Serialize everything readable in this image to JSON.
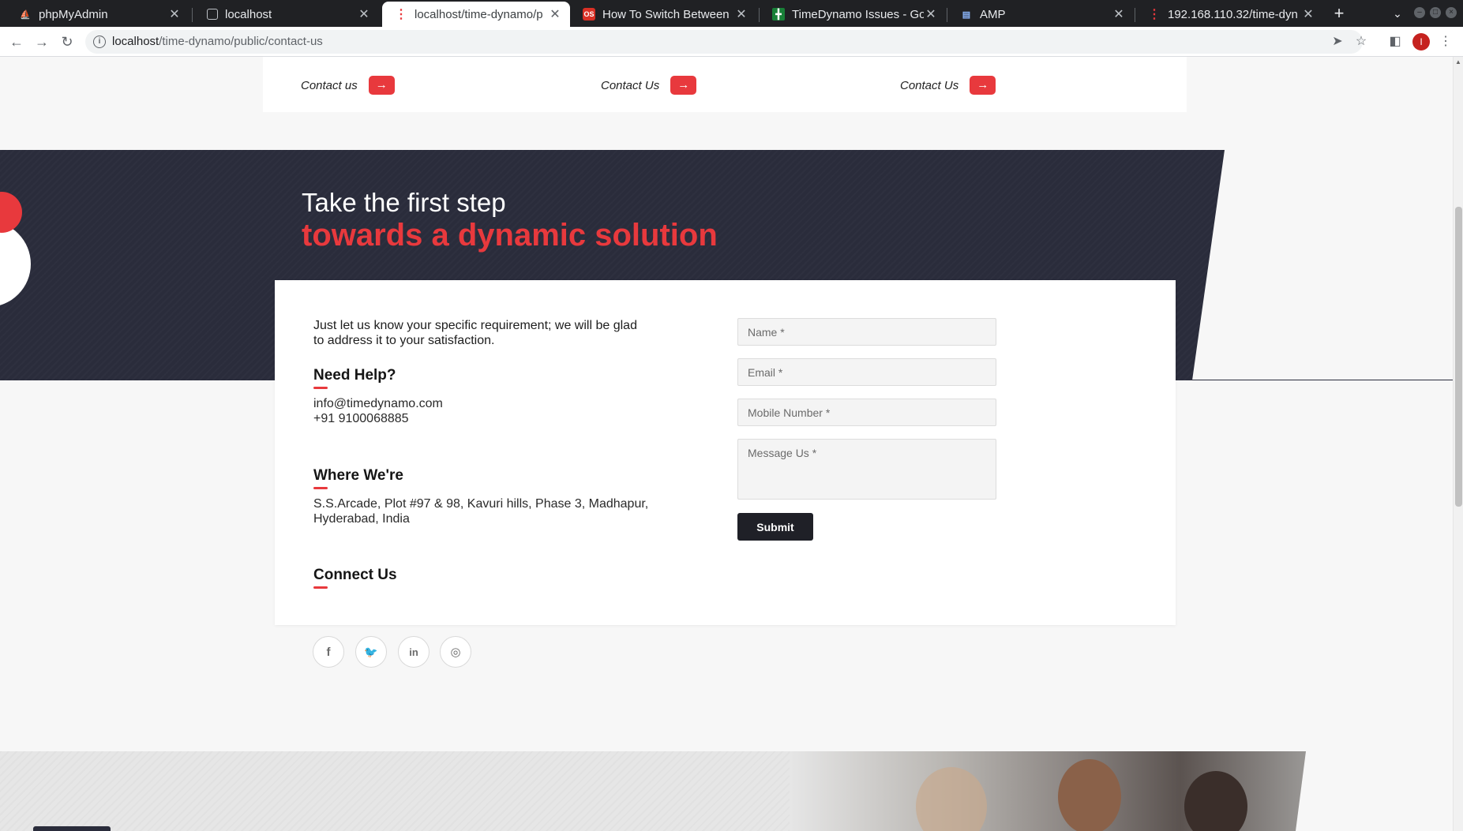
{
  "browser": {
    "tabs": [
      {
        "title": "phpMyAdmin",
        "active": false
      },
      {
        "title": "localhost",
        "active": false
      },
      {
        "title": "localhost/time-dynamo/p",
        "active": true
      },
      {
        "title": "How To Switch Between",
        "active": false
      },
      {
        "title": "TimeDynamo Issues - Goo",
        "active": false
      },
      {
        "title": "AMP",
        "active": false
      },
      {
        "title": "192.168.110.32/time-dyn",
        "active": false
      }
    ],
    "url_host": "localhost",
    "url_path": "/time-dynamo/public/contact-us",
    "profile_initial": "I"
  },
  "strip": {
    "links": [
      {
        "label": "Contact us"
      },
      {
        "label": "Contact Us"
      },
      {
        "label": "Contact Us"
      }
    ],
    "arrow": "→"
  },
  "hero": {
    "line1": "Take the first step",
    "line2": "towards a dynamic solution"
  },
  "contact": {
    "intro": "Just let us know your specific requirement; we will be glad to address it to your satisfaction.",
    "help_title": "Need Help?",
    "email": "info@timedynamo.com",
    "phone": "+91 9100068885",
    "where_title": "Where We're",
    "address": "S.S.Arcade, Plot #97 & 98, Kavuri hills, Phase 3, Madhapur, Hyderabad, India",
    "connect_title": "Connect Us",
    "socials": [
      {
        "name": "facebook",
        "glyph": "f"
      },
      {
        "name": "twitter",
        "glyph": "🐦"
      },
      {
        "name": "linkedin",
        "glyph": "in"
      },
      {
        "name": "instagram",
        "glyph": "◎"
      }
    ]
  },
  "form": {
    "name_placeholder": "Name *",
    "email_placeholder": "Email *",
    "mobile_placeholder": "Mobile Number *",
    "message_placeholder": "Message Us *",
    "submit_label": "Submit"
  },
  "colors": {
    "accent": "#e8393d",
    "dark": "#2a2c3b"
  }
}
